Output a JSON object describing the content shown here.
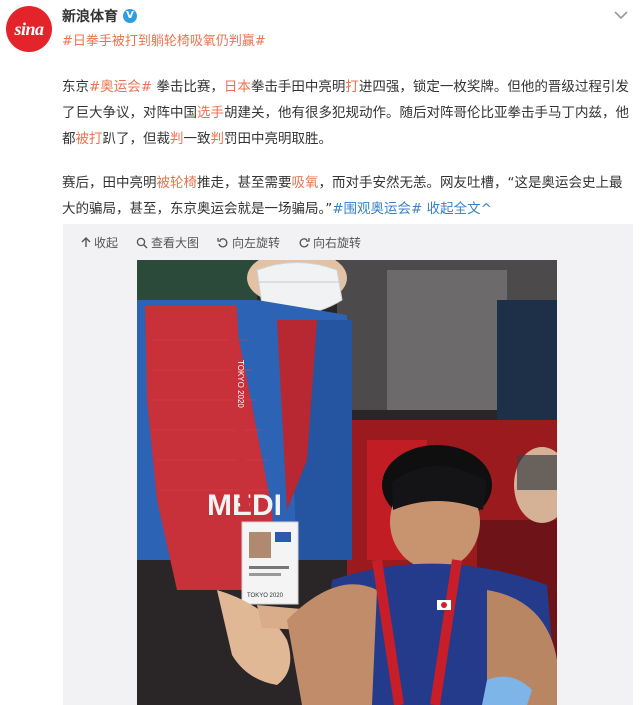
{
  "account": {
    "name": "新浪体育",
    "logo_text": "sina"
  },
  "topic": "#日拳手被打到躺轮椅吸氧仍判赢#",
  "post": {
    "p1": [
      "东京",
      "#奥运会#",
      " 拳击比赛，",
      "日本",
      "拳击手田中亮明",
      "打",
      "进四强，锁定一枚奖牌。但他的晋级过程引发了巨大争议，对阵中国",
      "选手",
      "胡建关，他有很多犯规动作。随后对阵哥伦比亚拳击手马丁内兹，他都",
      "被打",
      "趴了，但裁",
      "判",
      "一致",
      "判",
      "罚田中亮明取胜。"
    ],
    "p2": [
      "赛后，田中亮明",
      "被轮椅",
      "推走，甚至需要",
      "吸氧",
      "，而对手安然无恙。网友吐槽，“这是奥运会史上最大的骗局，甚至，东京奥运会就是一场骗局。”",
      "#围观奥运会#",
      " 收起全文",
      "^"
    ]
  },
  "toolbar": [
    {
      "icon": "collapse-icon",
      "label": "收起"
    },
    {
      "icon": "zoom-icon",
      "label": "查看大图"
    },
    {
      "icon": "rotate-left-icon",
      "label": "向左旋转"
    },
    {
      "icon": "rotate-right-icon",
      "label": "向右旋转"
    }
  ],
  "photo": {
    "vest_text": "MEDI",
    "badge_text": "TOKYO 2020",
    "strap_text": "TOKYO 2020"
  },
  "colors": {
    "brand": "#e3242b",
    "topic": "#eb7350",
    "link": "#3a80c4"
  }
}
